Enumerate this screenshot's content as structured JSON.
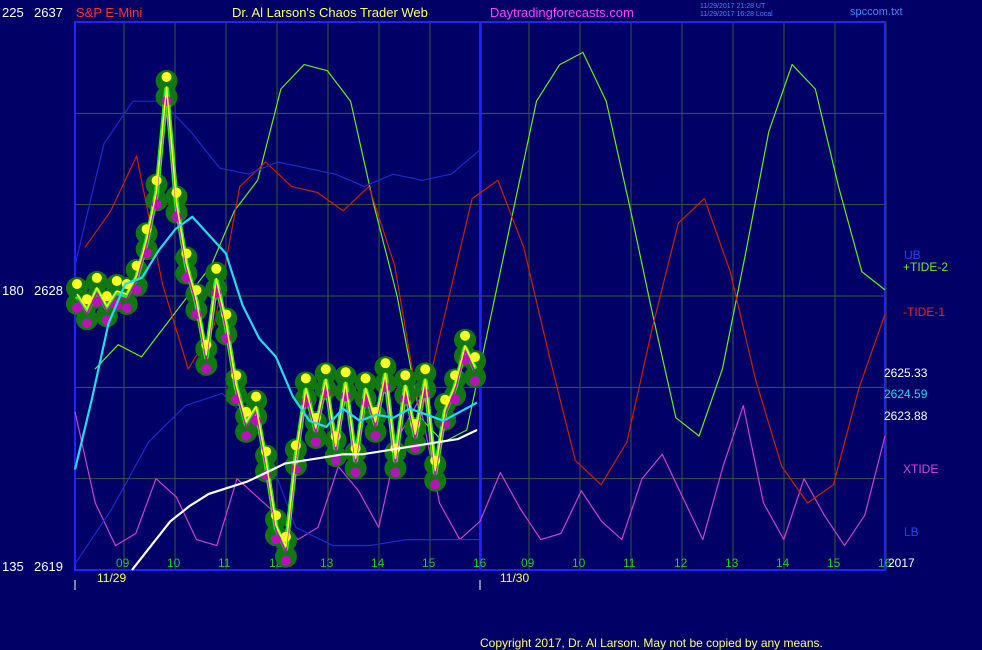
{
  "header": {
    "instrument": "S&P E-Mini",
    "author": "Dr. Al Larson's Chaos Trader Web",
    "site": "Daytradingforecasts.com",
    "timestamp_utc": "11/29/2017 21:28 UT",
    "timestamp_local": "11/29/2017 16:28 Local",
    "file": "spccom.txt"
  },
  "left_axis": {
    "top": {
      "index": "225",
      "price": "2637"
    },
    "mid": {
      "index": "180",
      "price": "2628"
    },
    "bottom": {
      "index": "135",
      "price": "2619"
    }
  },
  "right_labels": {
    "ub": "UB",
    "tide2": "+TIDE-2",
    "tide1": "-TIDE-1",
    "price1": "2625.33",
    "price2": "2624.59",
    "price3": "2623.88",
    "xtide": "XTIDE",
    "lb": "LB",
    "year": "2017"
  },
  "colors": {
    "background": "#000066",
    "frame": "#2222ff",
    "grid": "#3a5a3a",
    "tide2": "#66ee22",
    "tide1": "#cc2200",
    "xtide": "#cc44cc",
    "bands": "#1a2ccc",
    "price": "#22ee22",
    "dots_high": "#ffff22",
    "dots_low": "#bb11bb",
    "halo": "#117711",
    "cyan_ma": "#22ddee",
    "white_ma": "#ffffff",
    "header_red": "#ff3333",
    "header_yellow": "#ffff66",
    "header_magenta": "#ff44ff",
    "header_blue": "#4488ff",
    "copyright": "#ffff66"
  },
  "chart_data": {
    "type": "line",
    "x_hour_labels": [
      "09",
      "10",
      "11",
      "12",
      "13",
      "14",
      "15",
      "16",
      "09",
      "10",
      "11",
      "12",
      "13",
      "14",
      "15",
      "16"
    ],
    "x_date_labels": [
      "11/29",
      "11/30"
    ],
    "y_price_range": [
      2619,
      2637
    ],
    "y_index_range": [
      135,
      225
    ],
    "price_labels": [
      2625.33,
      2624.59,
      2623.88
    ],
    "series": [
      {
        "name": "+TIDE-2",
        "values": [
          168,
          172,
          170,
          175,
          180,
          185,
          194,
          199,
          214,
          218,
          217,
          212,
          195,
          180,
          160,
          156,
          158,
          176,
          194,
          212,
          218,
          220,
          212,
          195,
          177,
          160,
          157,
          168,
          187,
          207,
          218,
          214,
          198,
          184,
          181
        ]
      },
      {
        "name": "-TIDE-1",
        "values": [
          188,
          194,
          203,
          182,
          168,
          175,
          198,
          202,
          198,
          197,
          194,
          198,
          185,
          160,
          178,
          196,
          199,
          188,
          170,
          153,
          149,
          156,
          175,
          192,
          196,
          184,
          166,
          152,
          146,
          149,
          165,
          177
        ]
      },
      {
        "name": "XTIDE",
        "values": [
          161,
          146,
          139,
          141,
          150,
          147,
          140,
          139,
          150,
          147,
          144,
          140,
          142,
          152,
          148,
          142,
          157,
          163,
          146,
          140,
          143,
          151,
          145,
          140,
          141,
          148,
          143,
          140,
          150,
          154,
          147,
          140,
          152,
          162,
          146,
          140,
          150,
          144,
          139,
          144,
          157
        ]
      },
      {
        "name": "UB",
        "values": [
          185,
          205,
          212,
          212,
          207,
          201,
          200,
          202,
          201,
          200,
          198,
          200,
          199,
          200,
          204
        ]
      },
      {
        "name": "LB",
        "values": [
          136,
          145,
          156,
          162,
          164,
          158,
          142,
          139,
          139,
          140,
          140,
          140
        ]
      },
      {
        "name": "Price",
        "values": [
          2628.0,
          2627.5,
          2628.2,
          2627.6,
          2628.1,
          2628.0,
          2628.6,
          2629.8,
          2631.4,
          2634.8,
          2631.0,
          2629.0,
          2627.8,
          2626.0,
          2628.5,
          2627.0,
          2625.0,
          2623.8,
          2624.3,
          2622.5,
          2620.4,
          2619.7,
          2622.7,
          2624.9,
          2623.6,
          2625.2,
          2623.0,
          2625.1,
          2622.6,
          2624.9,
          2623.8,
          2625.4,
          2622.6,
          2625.0,
          2623.4,
          2625.2,
          2622.2,
          2624.2,
          2625.0,
          2626.3,
          2625.6
        ]
      },
      {
        "name": "Cyan MA",
        "values": [
          2622.3,
          2624.6,
          2627.1,
          2628.4,
          2628.6,
          2629.5,
          2630.2,
          2630.6,
          2630.0,
          2629.4,
          2627.7,
          2626.6,
          2626.0,
          2624.7,
          2623.9,
          2623.7,
          2624.3,
          2623.9,
          2624.1,
          2624.0,
          2624.3,
          2624.1,
          2623.9,
          2624.2,
          2624.5
        ]
      },
      {
        "name": "White MA",
        "values": [
          2619.0,
          2619.8,
          2620.6,
          2621.1,
          2621.5,
          2621.7,
          2621.9,
          2622.2,
          2622.5,
          2622.6,
          2622.7,
          2622.8,
          2622.8,
          2622.9,
          2623.0,
          2623.1,
          2623.2,
          2623.3,
          2623.6
        ]
      }
    ]
  },
  "copyright": "Copyright 2017, Dr. Al Larson. May not be copied by any means."
}
